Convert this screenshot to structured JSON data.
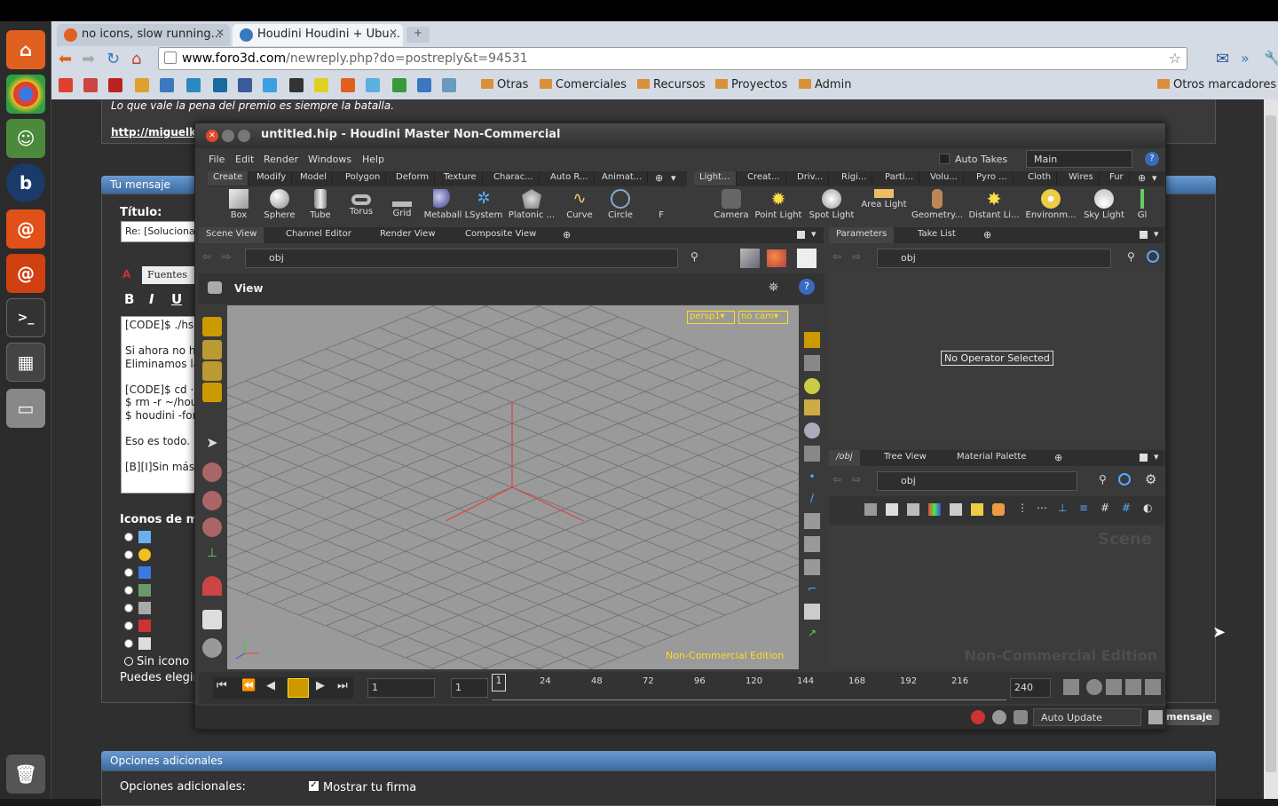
{
  "browser": {
    "tabs": [
      {
        "label": "no icons, slow running..."
      },
      {
        "label": "Houdini Houdini + Ubu..."
      }
    ],
    "url_domain": "www.foro3d.com",
    "url_path": "/newreply.php?do=postreply&t=94531",
    "bookmarks": {
      "folders": [
        "Otras",
        "Comerciales",
        "Recursos",
        "Proyectos",
        "Admin"
      ],
      "other": "Otros marcadores"
    }
  },
  "forum": {
    "quote": "Lo que vale la pena del premio es siempre la batalla.",
    "link": "http://miguelka",
    "section_title": "Tu mensaje",
    "titulo_label": "Título:",
    "titulo_value": "Re: [Solucionad",
    "fuentes_tab": "Fuentes",
    "bold": "B",
    "italic": "I",
    "underline": "U",
    "message_lines": [
      "[CODE]$ ./hs",
      "",
      "Si ahora no h",
      "Eliminamos la",
      "",
      "[CODE]$ cd ·",
      "$ rm -r ~/hou",
      "$ houdini -for",
      "",
      "Eso es todo.",
      "",
      "[B][I]Sin más"
    ],
    "iconos_label": "Iconos de me",
    "sin_icono": "Sin icono",
    "puedes_elegir": "Puedes elegir",
    "mensaje_btn": "mensaje",
    "opciones_title": "Opciones adicionales",
    "opciones_label": "Opciones adicionales:",
    "mostrar_firma": "Mostrar tu firma"
  },
  "houdini": {
    "title": "untitled.hip - Houdini Master Non-Commercial",
    "menu": [
      "File",
      "Edit",
      "Render",
      "Windows",
      "Help"
    ],
    "auto_takes": "Auto Takes",
    "main_select": "Main",
    "shelf_tabs_left": [
      "Create",
      "Modify",
      "Model",
      "Polygon",
      "Deform",
      "Texture",
      "Charac...",
      "Auto R...",
      "Animat..."
    ],
    "shelf_tabs_right": [
      "Light...",
      "Creat...",
      "Driv...",
      "Rigi...",
      "Parti...",
      "Volu...",
      "Pyro ...",
      "Cloth",
      "Wires",
      "Fur"
    ],
    "tools_left": [
      "Box",
      "Sphere",
      "Tube",
      "Torus",
      "Grid",
      "Metaball",
      "LSystem",
      "Platonic ...",
      "Curve",
      "Circle",
      "F"
    ],
    "tools_right": [
      "Camera",
      "Point Light",
      "Spot Light",
      "Area Light",
      "Geometry...",
      "Distant Li...",
      "Environm...",
      "Sky Light",
      "Gl"
    ],
    "pane_tabs_left": [
      "Scene View",
      "Channel Editor",
      "Render View",
      "Composite View"
    ],
    "pane_tabs_right": [
      "Parameters",
      "Take List"
    ],
    "path": "obj",
    "view_label": "View",
    "persp": "persp1▾",
    "nocam": "no cam▾",
    "watermark": "Non-Commercial Edition",
    "no_operator": "No Operator Selected",
    "net_tabs": [
      "/obj",
      "Tree View",
      "Material Palette"
    ],
    "scene_label": "Scene",
    "timeline": {
      "frame": "1",
      "start": "1",
      "end": "240",
      "ticks": [
        "24",
        "48",
        "72",
        "96",
        "120",
        "144",
        "168",
        "192",
        "216"
      ]
    },
    "auto_update": "Auto Update",
    "colors": {
      "accent": "#e0c020",
      "viewport": "#9a9a9a",
      "axis": "#e04040"
    }
  }
}
